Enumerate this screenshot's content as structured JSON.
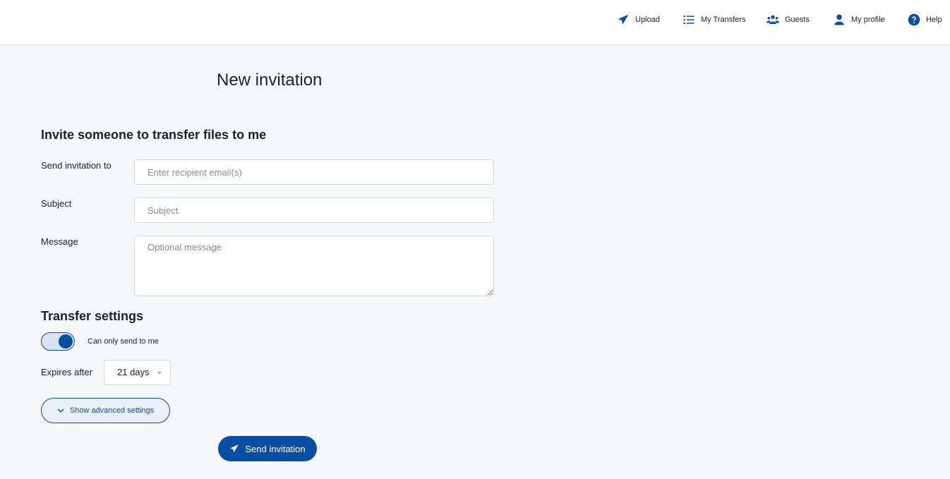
{
  "nav": {
    "upload": {
      "label": "Upload",
      "icon": "paper-plane-icon"
    },
    "my_transfers": {
      "label": "My Transfers",
      "icon": "list-icon"
    },
    "guests": {
      "label": "Guests",
      "icon": "users-icon"
    },
    "my_profile": {
      "label": "My profile",
      "icon": "user-icon"
    },
    "help": {
      "label": "Help",
      "icon": "question-circle-icon"
    }
  },
  "page": {
    "title": "New invitation"
  },
  "invite_section": {
    "title": "Invite someone to transfer files to me",
    "to_label": "Send invitation to",
    "to_placeholder": "Enter recipient email(s)",
    "subject_label": "Subject",
    "subject_placeholder": "Subject",
    "message_label": "Message",
    "message_placeholder": "Optional message"
  },
  "transfer_settings": {
    "title": "Transfer settings",
    "can_only_send_to_me_label": "Can only send to me",
    "can_only_send_to_me_enabled": true,
    "expires_label": "Expires after",
    "expires_value": "21 days",
    "advanced_button_label": "Show advanced settings"
  },
  "actions": {
    "send_label": "Send invitation"
  },
  "colors": {
    "primary": "#0a4ea3",
    "background": "#f5f7f9"
  }
}
